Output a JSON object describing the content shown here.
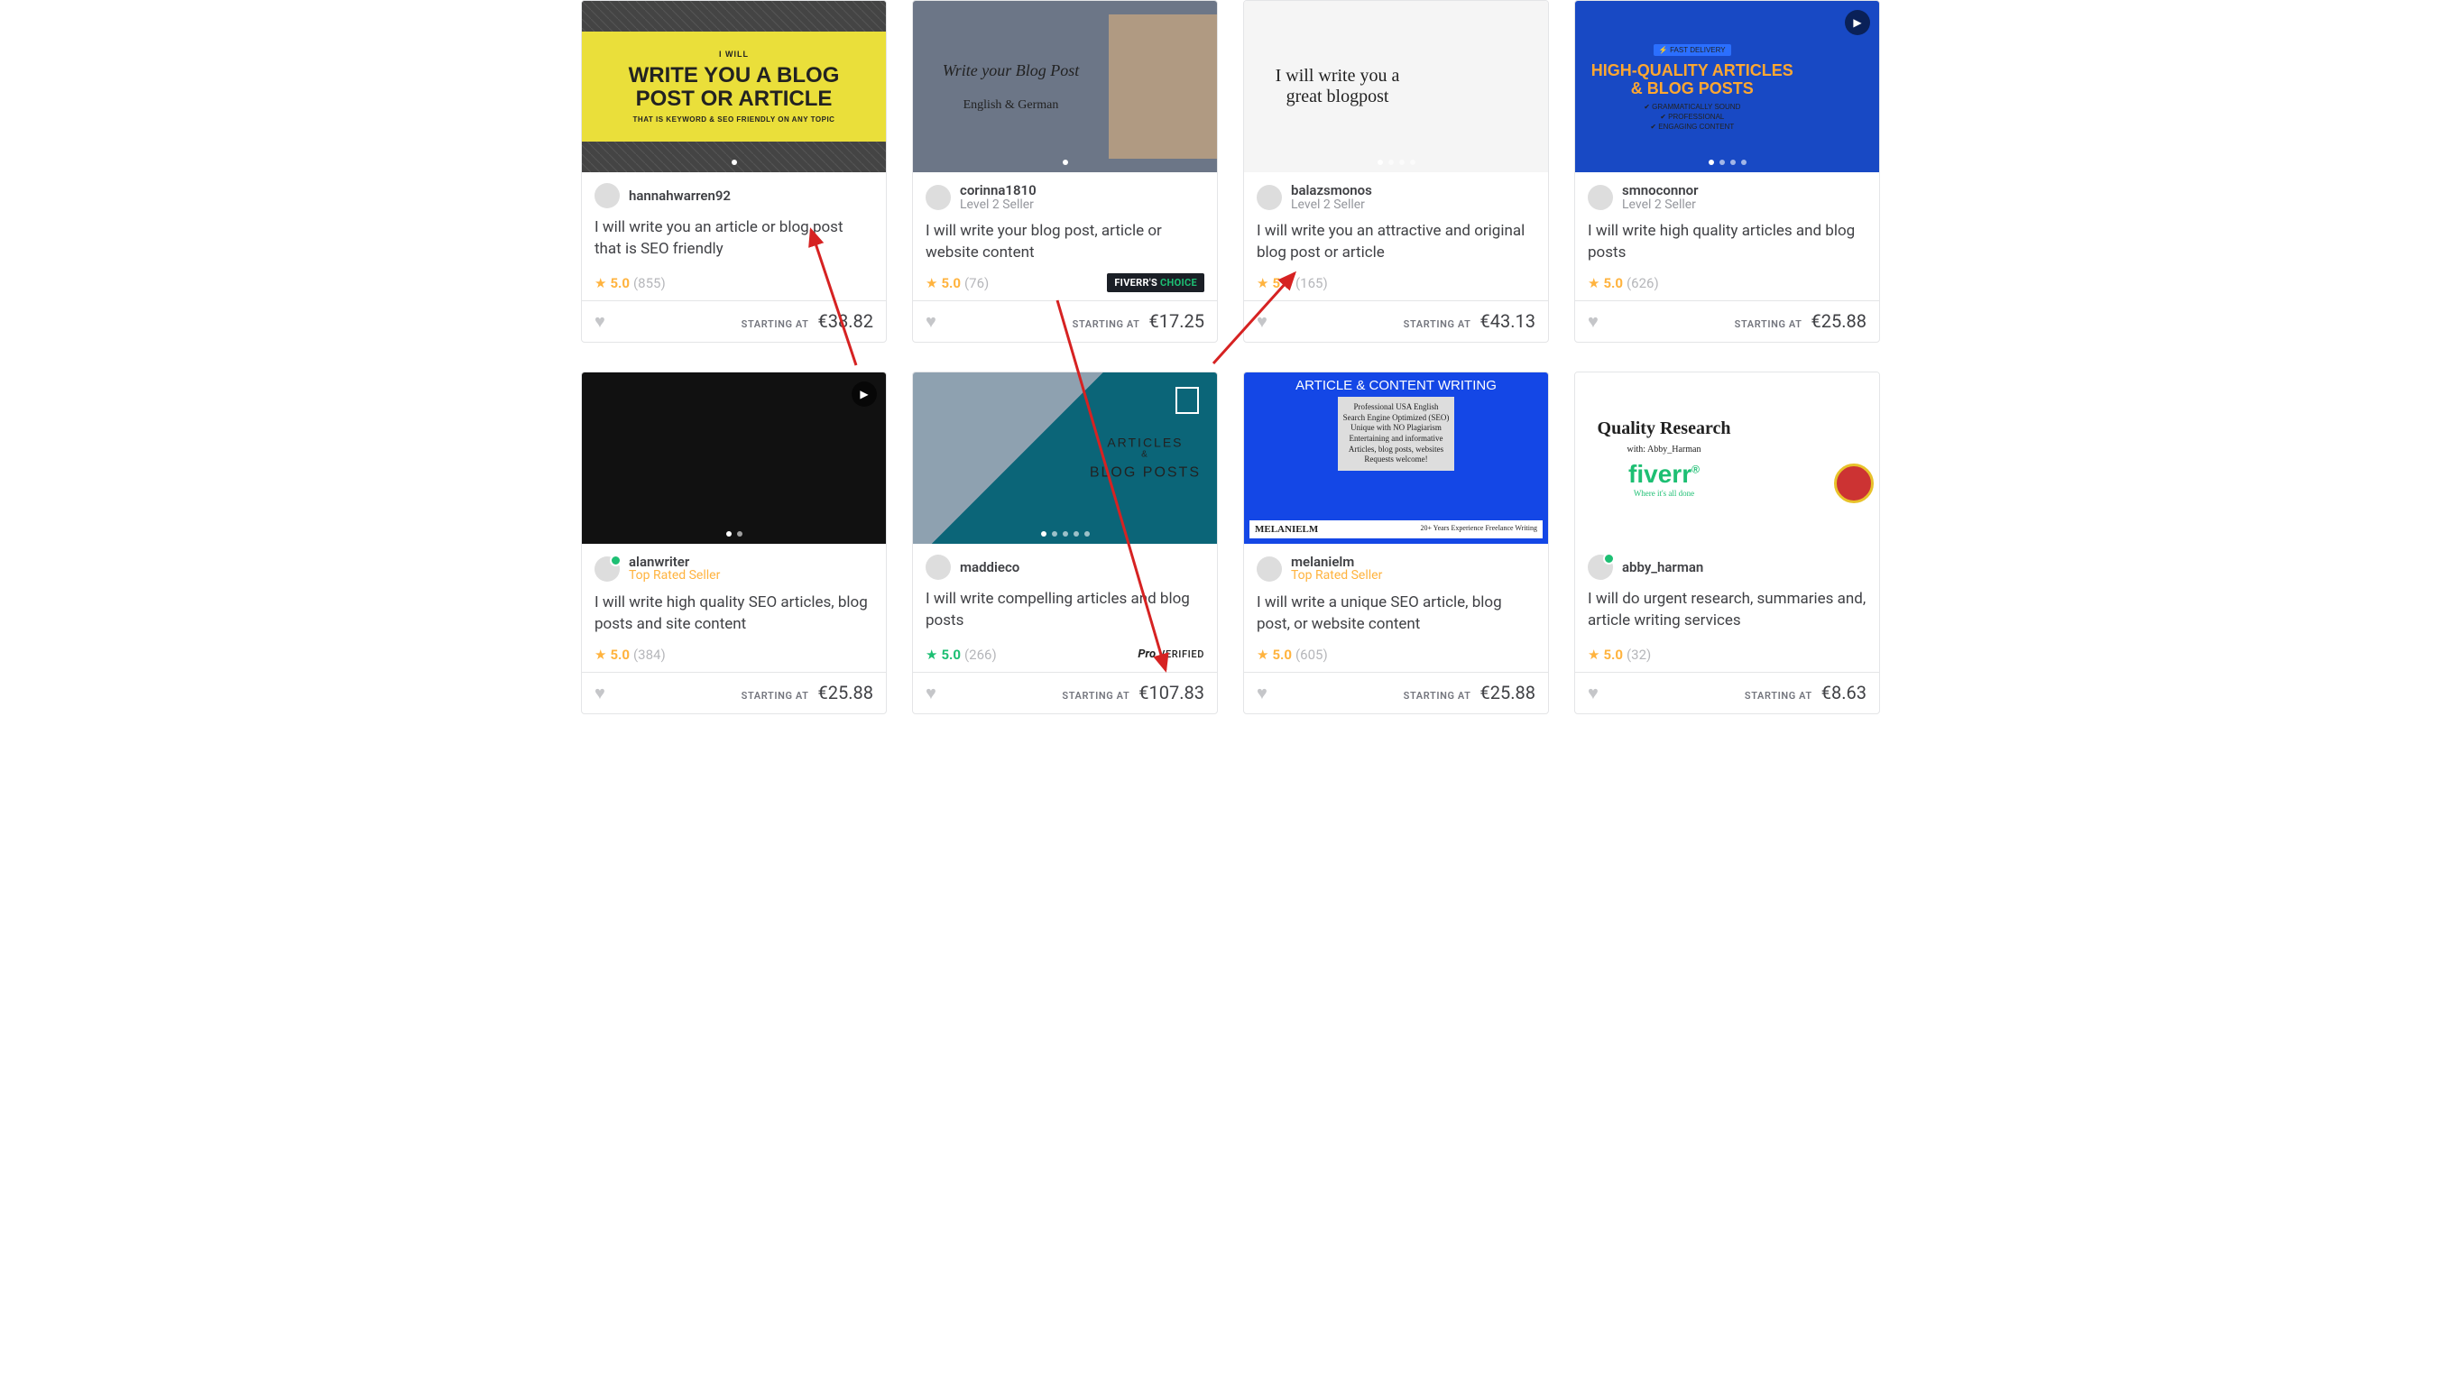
{
  "labels": {
    "starting_at": "STARTING AT"
  },
  "gigs": [
    {
      "seller": {
        "name": "hannahwarren92",
        "level": "",
        "online": false
      },
      "title": "I will write you an article or blog post that is SEO friendly",
      "rating": "5.0",
      "reviews": "855",
      "price": "€38.82",
      "thumb": {
        "variant": "t1",
        "lines": [
          "I WILL",
          "WRITE YOU A BLOG POST OR ARTICLE",
          "THAT IS KEYWORD & SEO FRIENDLY ON ANY TOPIC"
        ],
        "dots": 1
      },
      "badge": null,
      "teal": false,
      "play": false
    },
    {
      "seller": {
        "name": "corinna1810",
        "level": "Level 2 Seller",
        "online": false
      },
      "title": "I will write your blog post, article or website content",
      "rating": "5.0",
      "reviews": "76",
      "price": "€17.25",
      "thumb": {
        "variant": "t2",
        "lines": [
          "Write your Blog Post",
          "English & German"
        ],
        "dots": 1
      },
      "badge": "choice",
      "teal": false,
      "play": false
    },
    {
      "seller": {
        "name": "balazsmonos",
        "level": "Level 2 Seller",
        "online": false
      },
      "title": "I will write you an attractive and original blog post or article",
      "rating": "5.0",
      "reviews": "165",
      "price": "€43.13",
      "thumb": {
        "variant": "t3",
        "lines": [
          "I will write you a great blogpost"
        ],
        "dots": 4
      },
      "badge": null,
      "teal": false,
      "play": false
    },
    {
      "seller": {
        "name": "smnoconnor",
        "level": "Level 2 Seller",
        "online": false
      },
      "title": "I will write high quality articles and blog posts",
      "rating": "5.0",
      "reviews": "626",
      "price": "€25.88",
      "thumb": {
        "variant": "t4",
        "lines": [
          "FAST DELIVERY",
          "HIGH-QUALITY ARTICLES & BLOG POSTS",
          "GRAMMATICALLY SOUND",
          "PROFESSIONAL",
          "ENGAGING CONTENT"
        ],
        "dots": 4
      },
      "badge": null,
      "teal": false,
      "play": true
    },
    {
      "seller": {
        "name": "alanwriter",
        "level": "Top Rated Seller",
        "online": true
      },
      "title": "I will write high quality SEO articles, blog posts and site content",
      "rating": "5.0",
      "reviews": "384",
      "price": "€25.88",
      "thumb": {
        "variant": "t5",
        "lines": [],
        "dots": 2
      },
      "badge": null,
      "teal": false,
      "play": true
    },
    {
      "seller": {
        "name": "maddieco",
        "level": "",
        "online": false
      },
      "title": "I will write compelling articles and blog posts",
      "rating": "5.0",
      "reviews": "266",
      "price": "€107.83",
      "thumb": {
        "variant": "t6",
        "lines": [
          "ARTICLES",
          "BLOG POSTS"
        ],
        "dots": 5
      },
      "badge": "pro",
      "teal": true,
      "play": false
    },
    {
      "seller": {
        "name": "melanielm",
        "level": "Top Rated Seller",
        "online": false
      },
      "title": "I will write a unique SEO article, blog post, or website content",
      "rating": "5.0",
      "reviews": "605",
      "price": "€25.88",
      "thumb": {
        "variant": "t7",
        "lines": [
          "ARTICLE & CONTENT WRITING",
          "Professional USA English\nSearch Engine Optimized (SEO)\nUnique with NO Plagiarism\nEntertaining and informative\nArticles, blog posts, websites\nRequests welcome!",
          "MELANIELM",
          "20+ Years Experience Freelance Writing"
        ],
        "dots": 0
      },
      "badge": null,
      "teal": false,
      "play": false
    },
    {
      "seller": {
        "name": "abby_harman",
        "level": "",
        "online": true
      },
      "title": "I will do urgent research, summaries and, article writing services",
      "rating": "5.0",
      "reviews": "32",
      "price": "€8.63",
      "thumb": {
        "variant": "t8",
        "lines": [
          "Quality Research",
          "with: Abby_Harman",
          "fiverr",
          "Where it's all done"
        ],
        "dots": 0
      },
      "badge": null,
      "teal": false,
      "play": false
    }
  ]
}
